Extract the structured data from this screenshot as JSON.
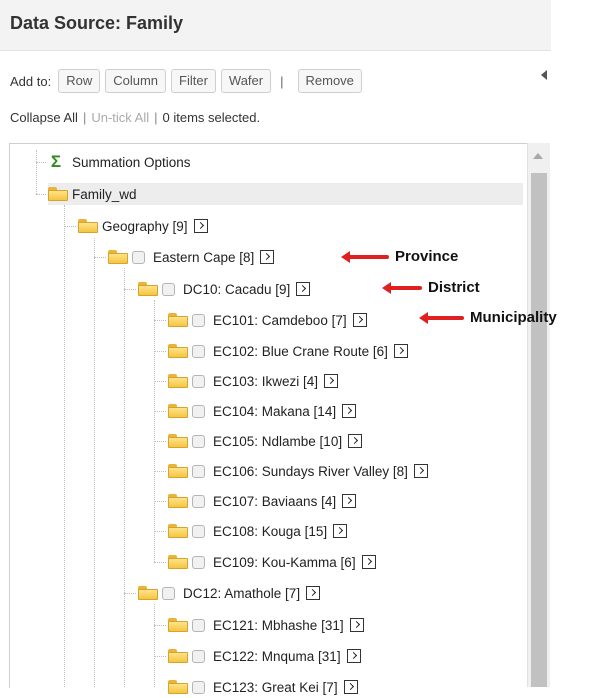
{
  "header": {
    "title": "Data Source: Family"
  },
  "toolbar": {
    "add_to_label": "Add to:",
    "buttons": {
      "row": "Row",
      "column": "Column",
      "filter": "Filter",
      "wafer": "Wafer",
      "remove": "Remove"
    },
    "separator": "|"
  },
  "links": {
    "collapse_all": "Collapse All",
    "untick_all": "Un-tick All",
    "items_selected": "0 items selected.",
    "pipe": "|"
  },
  "tree": {
    "summation": "Summation Options",
    "root": "Family_wd",
    "geography": "Geography [9]",
    "eastern_cape": "Eastern Cape [8]",
    "dc10": "DC10: Cacadu [9]",
    "dc10_items": [
      "EC101: Camdeboo [7]",
      "EC102: Blue Crane Route [6]",
      "EC103: Ikwezi [4]",
      "EC104: Makana [14]",
      "EC105: Ndlambe [10]",
      "EC106: Sundays River Valley [8]",
      "EC107: Baviaans [4]",
      "EC108: Kouga [15]",
      "EC109: Kou-Kamma [6]"
    ],
    "dc12": "DC12: Amathole [7]",
    "dc12_items": [
      "EC121: Mbhashe [31]",
      "EC122: Mnquma [31]",
      "EC123: Great Kei [7]"
    ]
  },
  "annotations": {
    "province": "Province",
    "district": "District",
    "municipality": "Municipality",
    "arrow_color": "#e02020"
  },
  "colors": {
    "folder": "#f4c542",
    "sigma": "#2f8a1e",
    "header_bg": "#f3f3f3"
  },
  "icons": [
    "sigma-icon",
    "folder-icon",
    "checkbox-icon",
    "expand-icon",
    "arrow-left-icon",
    "scroll-up-icon"
  ]
}
